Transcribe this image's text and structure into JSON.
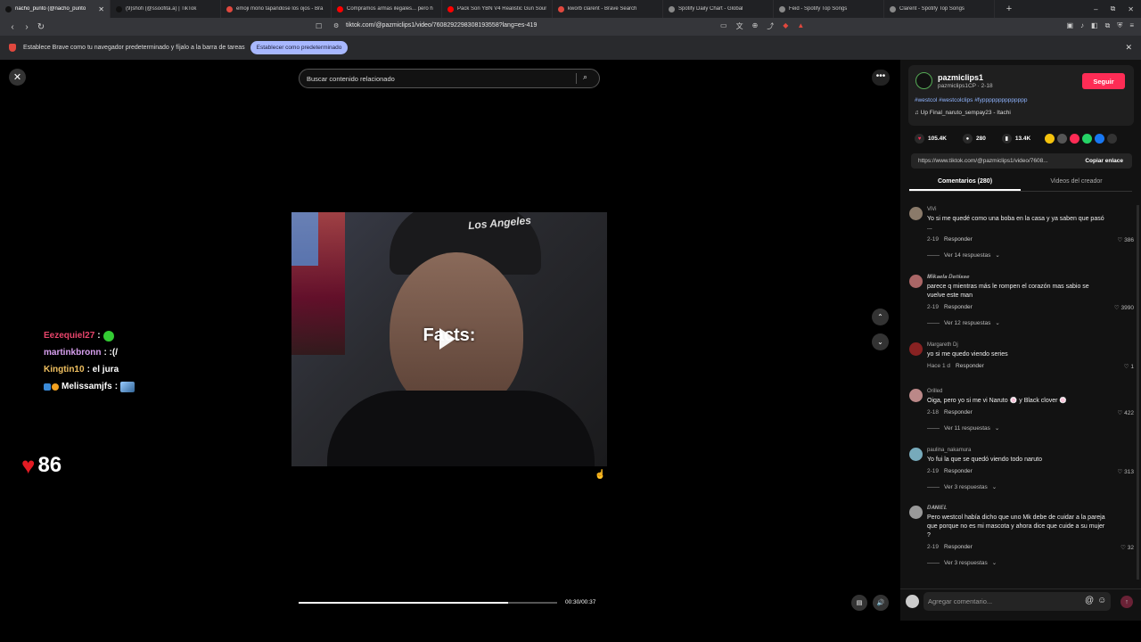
{
  "browser": {
    "tabs": [
      {
        "label": "nacho_punto (@nacho_punto",
        "color": "#111111",
        "active": true
      },
      {
        "label": "(9)shofi (@ssoofita.a) | TikTok",
        "color": "#111111"
      },
      {
        "label": "emoji mono tapandose los ojos - Bra",
        "color": "#e0483e"
      },
      {
        "label": "Compramos armas ilegales... pero h",
        "color": "#ff0000"
      },
      {
        "label": "Pack Son YBN V4 Realistic Gun Sounc",
        "color": "#ff0000"
      },
      {
        "label": "kworb clarent - Brave Search",
        "color": "#e0483e"
      },
      {
        "label": "Spotify Daily Chart - Global",
        "color": "#888888"
      },
      {
        "label": "Feid - Spotify Top Songs",
        "color": "#888888"
      },
      {
        "label": "Clarent - Spotify Top Songs",
        "color": "#888888"
      }
    ],
    "new_tab": "+",
    "url": "tiktok.com/@pazmiclips1/video/7608292298308193558?lang=es-419",
    "window_controls": {
      "minimize": "–",
      "maximize": "⧉",
      "close": "✕"
    }
  },
  "infobar": {
    "message": "Establece Brave como tu navegador predeterminado y fíjalo a la barra de tareas",
    "button": "Establecer como predeterminado",
    "close": "✕"
  },
  "player": {
    "search_placeholder": "Buscar contenido relacionado",
    "hat_logo": "Los Angeles",
    "caption": "Facts:",
    "progress": 0.81,
    "time": "00:30/00:37"
  },
  "overlay_chat": [
    {
      "user": "Eezequiel27",
      "color": "#e8456b",
      "msg": " : ",
      "emote": "green"
    },
    {
      "user": "martinkbronn",
      "color": "#d8a0f0",
      "msg": " : :(/"
    },
    {
      "user": "Kingtin10",
      "color": "#f0c060",
      "msg": " : el jura"
    },
    {
      "user": "Melissamjfs",
      "color": "#ffffff",
      "msg": " : ",
      "emote": "img",
      "badges": true
    }
  ],
  "hearts": {
    "count": "86"
  },
  "creator": {
    "name": "pazmiclips1",
    "meta": "pazmiclips1CP · 2-18",
    "follow": "Seguir",
    "hashtags": "#westcol #westcolclips #fypppppppppppppp",
    "music": "♫  Up Final_naruto_sempay23 - Itachi",
    "likes": "105.4K",
    "comments": "280",
    "saves": "13.4K",
    "link": "https://www.tiktok.com/@pazmiclips1/video/7608...",
    "copy": "Copiar enlace",
    "share_colors": [
      "#f4c20d",
      "#555555",
      "#fe2c55",
      "#25d366",
      "#1877f2",
      "#333333"
    ]
  },
  "tabs": {
    "comments": "Comentarios (280)",
    "creator_videos": "Videos del creador"
  },
  "comments": [
    {
      "user": "ViVi",
      "text": "Yo si me quedé como una boba en la casa y ya saben que pasó ...",
      "date": "2-19",
      "reply": "Responder",
      "likes": "386",
      "more": "Ver 14 respuestas",
      "avatar": "#8a7a6a"
    },
    {
      "user": "𝑴𝒊𝒌𝒂𝒆𝒍𝒂 𝑫𝒆𝒏𝒊𝒔𝒔𝒆",
      "text": "parece q mientras más le rompen el corazón mas sabio se vuelve este man",
      "date": "2-19",
      "reply": "Responder",
      "likes": "3990",
      "more": "Ver 12 respuestas",
      "avatar": "#a66"
    },
    {
      "user": "Margareth Dj",
      "text": "yo si me quedo viendo series",
      "date": "Hace 1 d",
      "reply": "Responder",
      "likes": "1",
      "more": "",
      "avatar": "#822"
    },
    {
      "user": "Orilled",
      "text": "Oiga, pero yo si me vi Naruto 🍥 y Black clover 🍥",
      "date": "2-18",
      "reply": "Responder",
      "likes": "422",
      "more": "Ver 11 respuestas",
      "avatar": "#b88"
    },
    {
      "user": "paulina_nakamura",
      "text": "Yo fui la que se quedó viendo todo naruto",
      "date": "2-19",
      "reply": "Responder",
      "likes": "313",
      "more": "Ver 3 respuestas",
      "avatar": "#7ab"
    },
    {
      "user": "𝑫𝑨𝑵𝑰𝑬𝑳",
      "text": "Pero westcol había dicho que uno Mk debe de cuidar a la pareja que porque no es mi mascota y ahora dice que cuide a su mujer ?",
      "date": "2-19",
      "reply": "Responder",
      "likes": "32",
      "more": "Ver 3 respuestas",
      "avatar": "#999"
    }
  ],
  "comment_input": {
    "placeholder": "Agregar comentario..."
  }
}
